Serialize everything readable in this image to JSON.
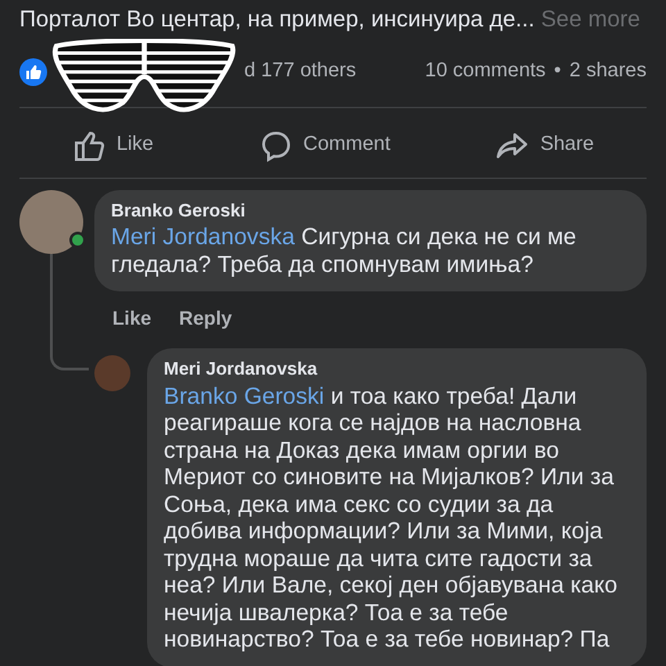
{
  "post": {
    "text": "Порталот Во центар, на пример, инсинуира де...",
    "see_more": "See more"
  },
  "reactions": {
    "text": "d 177 others",
    "comments": "10 comments",
    "separator": "•",
    "shares": "2 shares"
  },
  "actions": [
    {
      "kind": "like",
      "label": "Like"
    },
    {
      "kind": "comment",
      "label": "Comment"
    },
    {
      "kind": "share",
      "label": "Share"
    }
  ],
  "comments": [
    {
      "author": "Branko Geroski",
      "online": true,
      "mention": "Meri Jordanovska",
      "text": "Сигурна си дека не си ме гледала? Треба да спомнувам имиња?",
      "actions": [
        "Like",
        "Reply"
      ],
      "replies": [
        {
          "author": "Meri Jordanovska",
          "mention": "Branko Geroski",
          "text": "и тоа како треба! Дали реагираше кога се најдов на насловна страна на Доказ дека имам оргии во Мериот со синовите на Мијалков? Или за Соња, дека има секс со судии за да добива информации? Или за Мими, која трудна мораше да чита сите гадости за неа? Или Вале, секој ден објавувана како нечија швалерка? Тоа е за тебе новинарство? Тоа е за тебе новинар? Па"
        }
      ]
    }
  ]
}
